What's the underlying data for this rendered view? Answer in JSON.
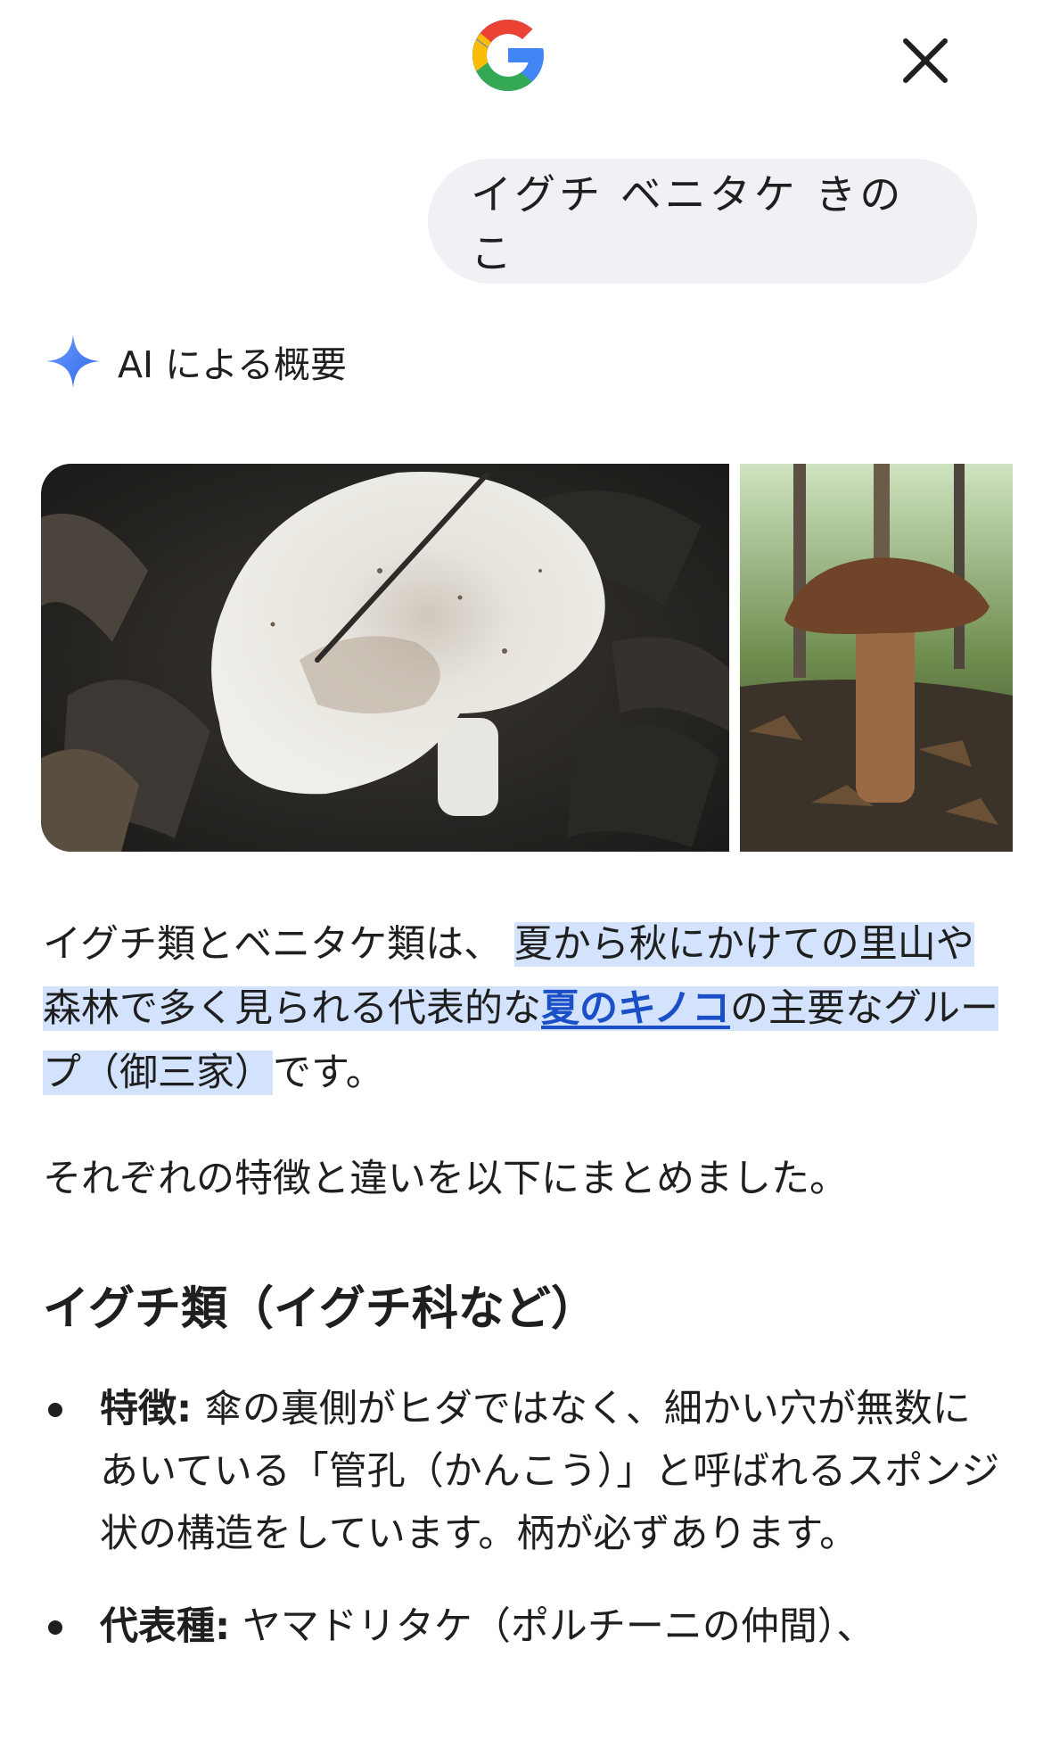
{
  "header": {
    "logo_name": "google-g-icon",
    "close_icon": "close-icon"
  },
  "query": {
    "text": "イグチ ベニタケ きのこ"
  },
  "ai_overview": {
    "label": "AI による概要",
    "icon": "sparkle-icon",
    "accent": "#4a7ef5"
  },
  "images": [
    {
      "name": "white-mushroom-image"
    },
    {
      "name": "brown-bolete-image"
    }
  ],
  "paragraph1": {
    "plain_start": "イグチ類とベニタケ類は、",
    "highlight_a": "夏から秋にかけての里山や森林で多く見られる代表的な",
    "link_text": "夏のキノコ",
    "highlight_b": "の主要なグループ（御三家）",
    "plain_end": "です。"
  },
  "paragraph2": "それぞれの特徴と違いを以下にまとめました。",
  "section_heading": "イグチ類（イグチ科など）",
  "bullets": [
    {
      "label": "特徴:",
      "text": "傘の裏側がヒダではなく、細かい穴が無数にあいている「管孔（かんこう）」と呼ばれるスポンジ状の構造をしています。柄が必ずあります。"
    },
    {
      "label": "代表種:",
      "text": "ヤマドリタケ（ポルチーニの仲間）、"
    }
  ],
  "colors": {
    "highlight": "#d3e3fd",
    "link": "#1a4fc8",
    "bubble": "#f0f1f5"
  }
}
